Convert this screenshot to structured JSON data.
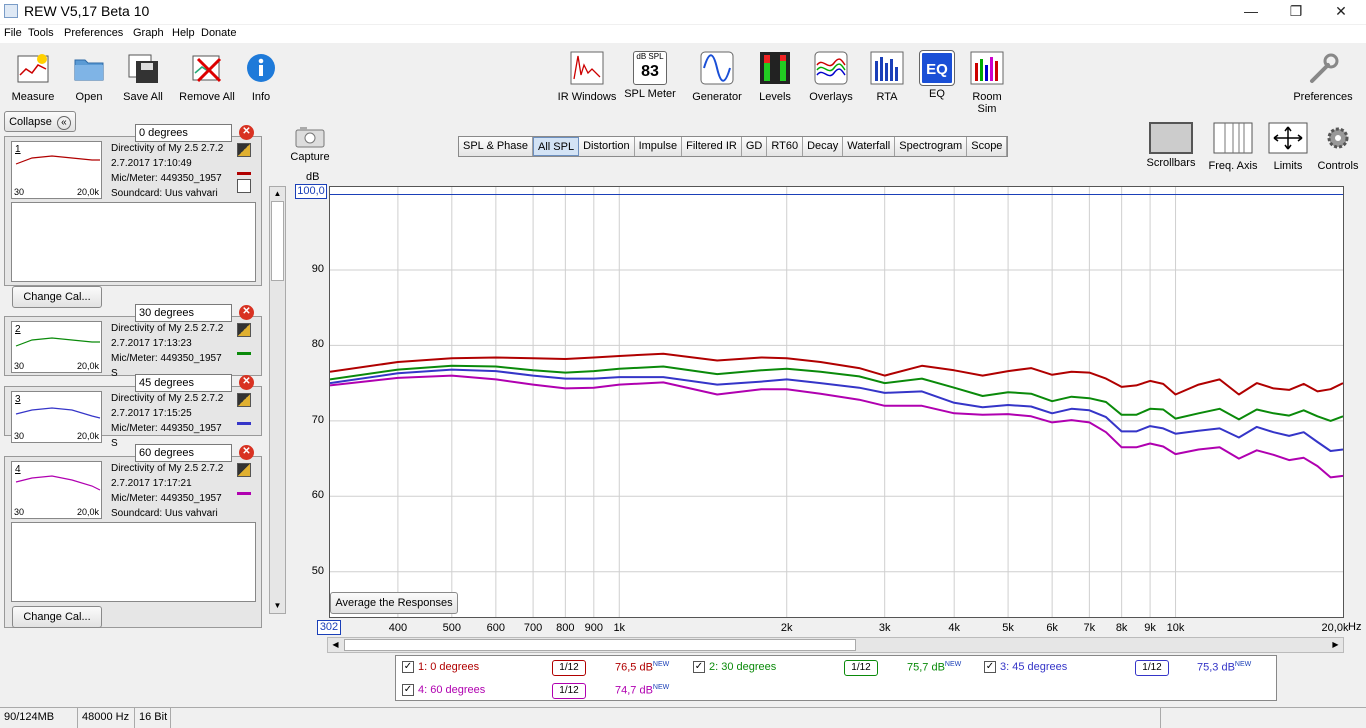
{
  "window": {
    "title": "REW V5,17 Beta 10"
  },
  "menu": [
    "File",
    "Tools",
    "Preferences",
    "Graph",
    "Help",
    "Donate"
  ],
  "toolbar_left": [
    "Measure",
    "Open",
    "Save All",
    "Remove All",
    "Info"
  ],
  "toolbar_center": [
    "IR Windows",
    "SPL Meter",
    "Generator",
    "Levels",
    "Overlays",
    "RTA",
    "EQ",
    "Room Sim"
  ],
  "spl_meter_icon": {
    "unit": "dB SPL",
    "value": "83"
  },
  "toolbar_right": {
    "preferences": "Preferences"
  },
  "graph_tools": [
    "Scrollbars",
    "Freq. Axis",
    "Limits",
    "Controls"
  ],
  "capture": "Capture",
  "collapse": "Collapse",
  "change_cal": "Change Cal...",
  "measurements": [
    {
      "num": "1",
      "name": "0 degrees",
      "line1": "Directivity of My 2.5 2.7.2",
      "line2": "2.7.2017 17:10:49",
      "line3": "Mic/Meter: 449350_1957",
      "line4": "Soundcard: Uus vahvari",
      "color": "#b00000"
    },
    {
      "num": "2",
      "name": "30 degrees",
      "line1": "Directivity of My 2.5 2.7.2",
      "line2": "2.7.2017 17:13:23",
      "line3": "Mic/Meter: 449350_1957",
      "line4": "S",
      "color": "#0a8a0a"
    },
    {
      "num": "3",
      "name": "45 degrees",
      "line1": "Directivity of My 2.5 2.7.2",
      "line2": "2.7.2017 17:15:25",
      "line3": "Mic/Meter: 449350_1957",
      "line4": "S",
      "color": "#3535c8"
    },
    {
      "num": "4",
      "name": "60 degrees",
      "line1": "Directivity of My 2.5 2.7.2",
      "line2": "2.7.2017 17:17:21",
      "line3": "Mic/Meter: 449350_1957",
      "line4": "Soundcard: Uus vahvari",
      "color": "#b000b0"
    }
  ],
  "thumb_axis": {
    "lo": "30",
    "hi": "20,0k"
  },
  "tabs": [
    "SPL & Phase",
    "All SPL",
    "Distortion",
    "Impulse",
    "Filtered IR",
    "GD",
    "RT60",
    "Decay",
    "Waterfall",
    "Spectrogram",
    "Scope"
  ],
  "active_tab": "All SPL",
  "avg_button": "Average the Responses",
  "chart_data": {
    "type": "line",
    "ylabel": "dB",
    "xlabel_unit": "Hz",
    "y_top_field": "100,0",
    "x_left_field": "302",
    "ylim": [
      44,
      101
    ],
    "xlim": [
      302,
      20000
    ],
    "x_scale": "log",
    "grid": true,
    "y_ticks": [
      "90",
      "80",
      "70",
      "60",
      "50"
    ],
    "y_tick_values": [
      90,
      80,
      70,
      60,
      50
    ],
    "x_ticks": [
      "400",
      "500",
      "600",
      "700",
      "800",
      "900",
      "1k",
      "2k",
      "3k",
      "4k",
      "5k",
      "6k",
      "7k",
      "8k",
      "9k",
      "10k",
      "20,0k"
    ],
    "x_tick_values": [
      400,
      500,
      600,
      700,
      800,
      900,
      1000,
      2000,
      3000,
      4000,
      5000,
      6000,
      7000,
      8000,
      9000,
      10000,
      20000
    ],
    "x": [
      302,
      400,
      500,
      600,
      700,
      800,
      900,
      1000,
      1200,
      1500,
      1800,
      2000,
      2300,
      2700,
      3000,
      3500,
      4000,
      4500,
      5000,
      5500,
      6000,
      6500,
      7000,
      7500,
      8000,
      8500,
      9000,
      9500,
      10000,
      11000,
      12000,
      13000,
      14000,
      15000,
      16000,
      17000,
      18000,
      19000,
      20000
    ],
    "series": [
      {
        "name": "1: 0 degrees",
        "color": "#b00000",
        "values": [
          76.5,
          77.8,
          78.3,
          78.4,
          78.3,
          78.2,
          78.4,
          78.6,
          78.9,
          78.0,
          78.4,
          78.3,
          77.8,
          77.0,
          76.0,
          77.3,
          76.7,
          76.0,
          76.6,
          77.0,
          76.1,
          76.5,
          76.4,
          75.6,
          74.5,
          74.7,
          75.3,
          74.9,
          73.5,
          74.8,
          75.5,
          73.5,
          75.0,
          74.3,
          74.1,
          74.9,
          73.9,
          74.2,
          75.0
        ]
      },
      {
        "name": "2: 30 degrees",
        "color": "#0a8a0a",
        "values": [
          75.5,
          76.8,
          77.3,
          77.2,
          76.7,
          76.4,
          76.6,
          76.9,
          77.2,
          76.2,
          76.7,
          76.9,
          76.5,
          75.9,
          75.0,
          75.6,
          74.4,
          73.3,
          73.8,
          73.6,
          72.6,
          73.2,
          73.0,
          72.5,
          70.8,
          70.8,
          71.6,
          71.5,
          70.3,
          71.0,
          71.6,
          70.2,
          71.5,
          71.0,
          70.7,
          71.4,
          70.6,
          70.0,
          70.6
        ]
      },
      {
        "name": "3: 45 degrees",
        "color": "#3535c8",
        "values": [
          75.0,
          76.3,
          76.8,
          76.6,
          76.0,
          75.6,
          75.6,
          75.8,
          75.8,
          74.8,
          75.2,
          75.5,
          75.0,
          74.4,
          73.7,
          73.9,
          72.4,
          71.8,
          72.1,
          71.9,
          71.0,
          71.6,
          71.4,
          70.5,
          68.6,
          68.6,
          69.3,
          69.0,
          68.3,
          68.7,
          69.0,
          67.8,
          69.2,
          68.5,
          68.0,
          68.5,
          67.2,
          66.0,
          66.2
        ]
      },
      {
        "name": "4: 60 degrees",
        "color": "#b000b0",
        "values": [
          74.7,
          75.7,
          76.0,
          75.5,
          74.8,
          74.3,
          74.4,
          74.8,
          75.1,
          73.5,
          74.2,
          74.2,
          73.6,
          72.8,
          72.0,
          72.0,
          71.0,
          70.8,
          70.9,
          70.6,
          69.8,
          70.1,
          69.8,
          68.5,
          66.5,
          66.5,
          67.0,
          66.6,
          65.6,
          66.2,
          66.5,
          65.0,
          66.1,
          65.5,
          64.8,
          65.1,
          64.0,
          62.5,
          62.7
        ]
      }
    ]
  },
  "legend": [
    {
      "label": "1: 0 degrees",
      "smoothing": "1/12",
      "spl": "76,5 dB",
      "tag": "NEW",
      "color": "#b00000"
    },
    {
      "label": "2: 30 degrees",
      "smoothing": "1/12",
      "spl": "75,7 dB",
      "tag": "NEW",
      "color": "#0a8a0a"
    },
    {
      "label": "3: 45 degrees",
      "smoothing": "1/12",
      "spl": "75,3 dB",
      "tag": "NEW",
      "color": "#3535c8"
    },
    {
      "label": "4: 60 degrees",
      "smoothing": "1/12",
      "spl": "74,7 dB",
      "tag": "NEW",
      "color": "#b000b0"
    }
  ],
  "status": {
    "memory": "90/124MB",
    "rate": "48000 Hz",
    "bits": "16 Bit"
  }
}
